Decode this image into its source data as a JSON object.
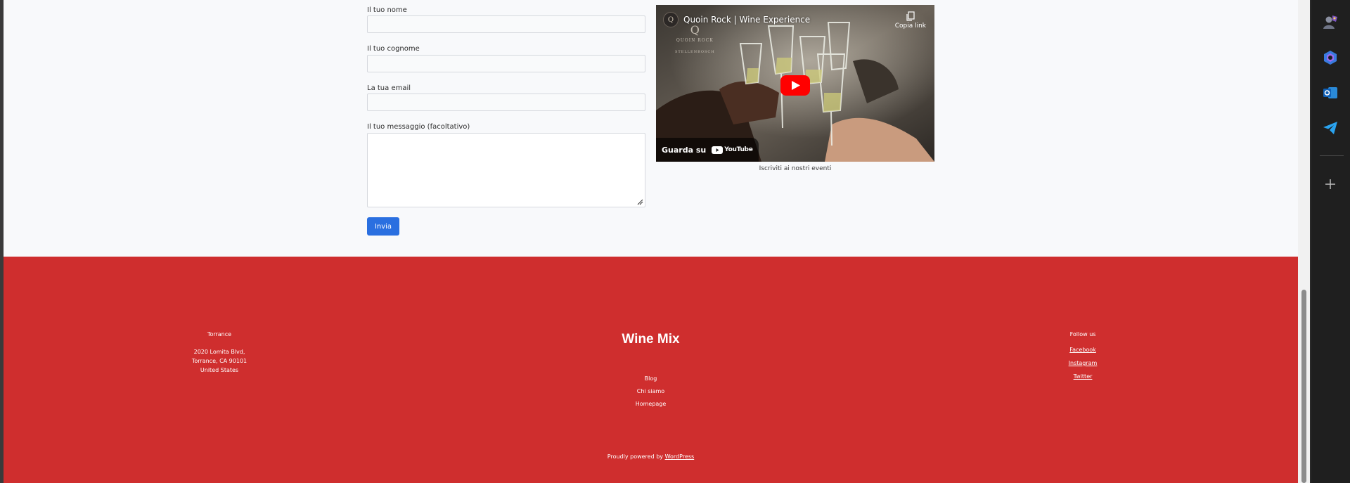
{
  "form": {
    "first_name_label": "Il tuo nome",
    "first_name_value": "",
    "last_name_label": "Il tuo cognome",
    "last_name_value": "",
    "email_label": "La tua email",
    "email_value": "",
    "message_label": "Il tuo messaggio (facoltativo)",
    "message_value": "",
    "submit_label": "Invia",
    "submit_color": "#2a6fe0"
  },
  "video": {
    "title": "Quoin Rock | Wine Experience",
    "channel_initial": "Q",
    "brand_line1": "QUOIN ROCK",
    "brand_line2": "STELLENBOSCH",
    "copy_link_label": "Copia link",
    "watch_label": "Guarda su",
    "youtube_label": "YouTube",
    "caption": "Iscriviti ai nostri eventi"
  },
  "footer": {
    "background_color": "#cf2e2e",
    "address_title": "Torrance",
    "address_lines": [
      "2020 Lomita Blvd,",
      "Torrance, CA 90101",
      "United States"
    ],
    "site_title": "Wine Mix",
    "nav_items": [
      "Blog",
      "Chi siamo",
      "Homepage"
    ],
    "follow_title": "Follow us",
    "social_links": [
      "Facebook",
      "Instagram",
      "Twitter"
    ],
    "powered_prefix": "Proudly powered by ",
    "powered_link": "WordPress"
  },
  "sidebar": {
    "icons": [
      "persona-icon",
      "copilot-icon",
      "outlook-icon",
      "telegram-icon",
      "add-icon"
    ]
  }
}
